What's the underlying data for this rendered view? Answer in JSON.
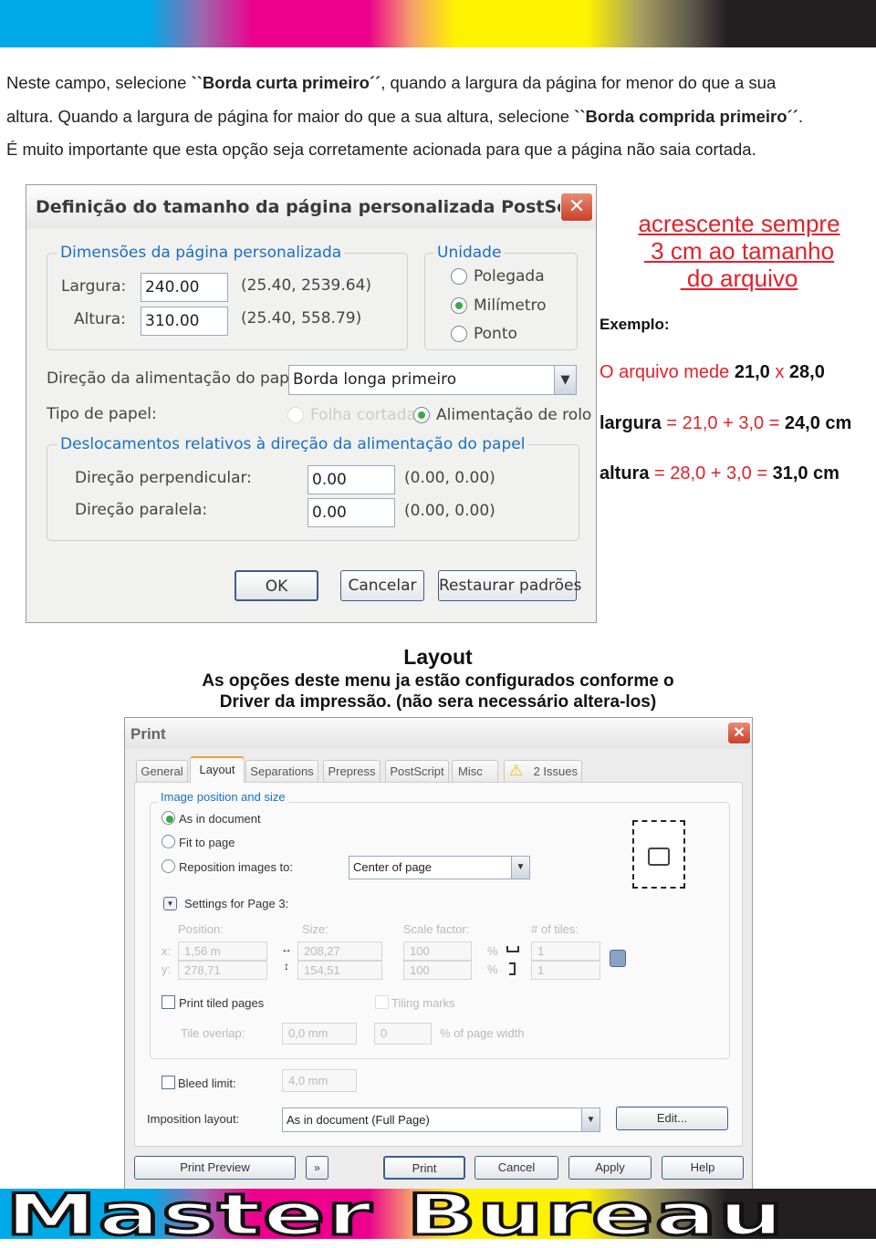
{
  "intro": {
    "line1_a": "Neste campo, selecione ",
    "line1_b": "``Borda curta primeiro´´",
    "line1_c": ", quando a largura da página for menor do que a sua",
    "line2_a": "altura. Quando a largura de página for maior do que a sua altura, selecione ",
    "line2_b": "``Borda comprida primeiro´´",
    "line2_c": ".",
    "line3": "É muito importante que esta opção seja corretamente acionada para que a página não saia cortada."
  },
  "dialog1": {
    "title": "Definição do tamanho da página personalizada PostScr...",
    "close": "✕",
    "dimensions_legend": "Dimensões da página personalizada",
    "width_label": "Largura:",
    "width_value": "240.00",
    "width_range": "(25.40, 2539.64)",
    "height_label": "Altura:",
    "height_value": "310.00",
    "height_range": "(25.40, 558.79)",
    "unit_legend": "Unidade",
    "units": [
      {
        "label": "Polegada",
        "selected": false
      },
      {
        "label": "Milímetro",
        "selected": true
      },
      {
        "label": "Ponto",
        "selected": false
      }
    ],
    "feed_label": "Direção da alimentação do papel:",
    "feed_value": "Borda longa primeiro",
    "paper_type_label": "Tipo de papel:",
    "paper_cut": "Folha cortada",
    "paper_roll": "Alimentação de rolo",
    "offset_legend": "Deslocamentos relativos à direção da alimentação do papel",
    "perp_label": "Direção perpendicular:",
    "perp_value": "0.00",
    "perp_range": "(0.00, 0.00)",
    "par_label": "Direção paralela:",
    "par_value": "0.00",
    "par_range": "(0.00, 0.00)",
    "ok": "OK",
    "cancel": "Cancelar",
    "restore": "Restaurar padrões"
  },
  "note": {
    "line1": "acrescente sempre",
    "line2": " 3 cm ao tamanho",
    "line3": " do arquivo",
    "example_label": "Exemplo:",
    "ex1_a": "O arquivo mede ",
    "ex1_b": "21,0",
    "ex1_c": " x ",
    "ex1_d": "28,0",
    "ex2_a": "largura",
    "ex2_b": " = 21,0 + 3,0 = ",
    "ex2_c": "24,0 cm",
    "ex3_a": "altura",
    "ex3_b": " = 28,0 + 3,0 = ",
    "ex3_c": "31,0 cm"
  },
  "layout_section": {
    "heading": "Layout",
    "desc1": "As opções deste menu ja estão configurados conforme o",
    "desc2": "Driver da impressão. (não sera necessário altera-los)"
  },
  "print_dialog": {
    "title": "Print",
    "close": "✕",
    "tabs": [
      "General",
      "Layout",
      "Separations",
      "Prepress",
      "PostScript",
      "Misc",
      "2 Issues"
    ],
    "active_tab": "Layout",
    "group_legend": "Image position and size",
    "opt_as_doc": "As in document",
    "opt_fit": "Fit to page",
    "opt_reposition": "Reposition images to:",
    "reposition_value": "Center of page",
    "settings_label": "Settings for Page 3:",
    "position_label": "Position:",
    "size_label": "Size:",
    "scale_label": "Scale factor:",
    "tiles_label": "# of tiles:",
    "x_label": "x:",
    "y_label": "y:",
    "pos_x": "1,56 m",
    "pos_y": "278,71",
    "size_w": "208,27",
    "size_h": "154,51",
    "scale_x": "100",
    "scale_y": "100",
    "pct": "%",
    "tiles_x": "1",
    "tiles_y": "1",
    "print_tiled": "Print tiled pages",
    "tiling_marks": "Tiling marks",
    "tile_overlap_label": "Tile overlap:",
    "tile_overlap_value": "0,0 mm",
    "tile_overlap_pct": "0",
    "pct_page_width": "% of page width",
    "bleed_label": "Bleed limit:",
    "bleed_value": "4,0 mm",
    "imposition_label": "Imposition layout:",
    "imposition_value": "As in document (Full Page)",
    "edit": "Edit...",
    "print_preview": "Print Preview",
    "print": "Print",
    "cancel": "Cancel",
    "apply": "Apply",
    "help": "Help"
  },
  "brand": "Master Bureau",
  "colors": {
    "cyan": "#00a9e8",
    "magenta": "#ec008c",
    "yellow": "#fff200",
    "black": "#231f20",
    "note_red": "#e4202a",
    "legend_blue": "#1a6fc4"
  }
}
